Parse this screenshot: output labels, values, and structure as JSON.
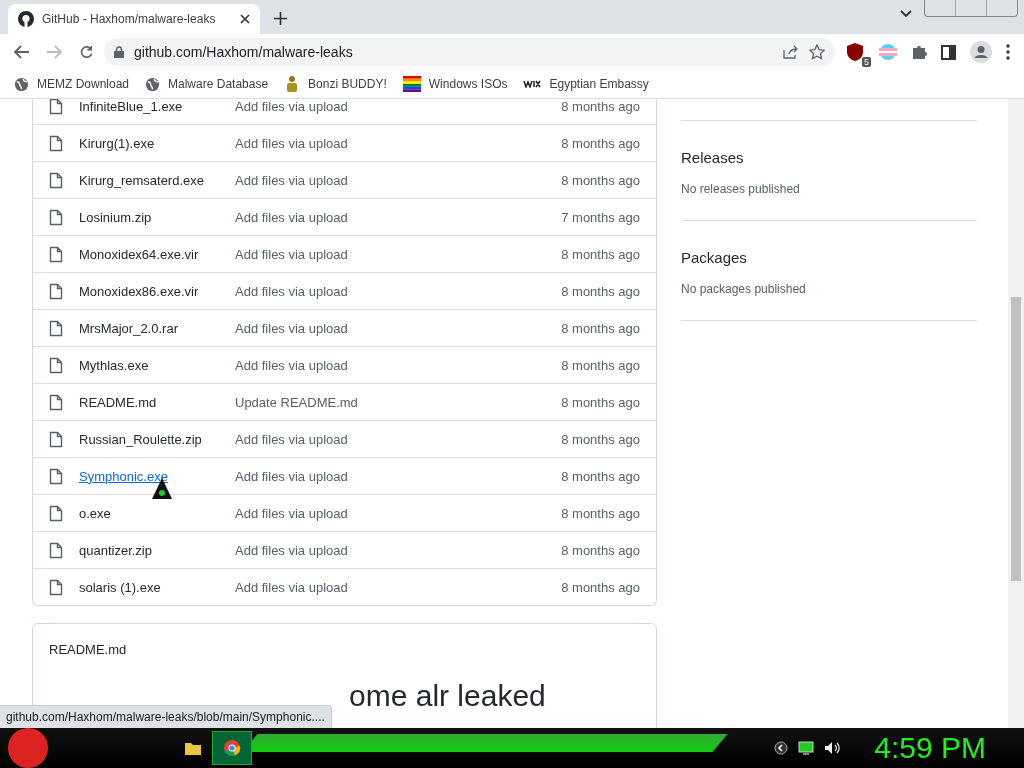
{
  "browser": {
    "tab": {
      "title": "GitHub - Haxhom/malware-leaks",
      "selected": true
    },
    "address": "github.com/Haxhom/malware-leaks",
    "extension_badge": "5",
    "bookmarks": [
      {
        "label": "MEMZ Download",
        "kind": "globe"
      },
      {
        "label": "Malware Database",
        "kind": "globe"
      },
      {
        "label": "Bonzi BUDDY!",
        "kind": "figure"
      },
      {
        "label": "Windows ISOs",
        "kind": "rainbow"
      },
      {
        "label": "Egyptian Embassy",
        "kind": "wix"
      }
    ]
  },
  "files": [
    {
      "name": "InfiniteBlue_1.exe",
      "message": "Add files via upload",
      "age": "8 months ago",
      "hovered": false
    },
    {
      "name": "Kirurg(1).exe",
      "message": "Add files via upload",
      "age": "8 months ago",
      "hovered": false
    },
    {
      "name": "Kirurg_remsaterd.exe",
      "message": "Add files via upload",
      "age": "8 months ago",
      "hovered": false
    },
    {
      "name": "Losinium.zip",
      "message": "Add files via upload",
      "age": "7 months ago",
      "hovered": false
    },
    {
      "name": "Monoxidex64.exe.vir",
      "message": "Add files via upload",
      "age": "8 months ago",
      "hovered": false
    },
    {
      "name": "Monoxidex86.exe.vir",
      "message": "Add files via upload",
      "age": "8 months ago",
      "hovered": false
    },
    {
      "name": "MrsMajor_2.0.rar",
      "message": "Add files via upload",
      "age": "8 months ago",
      "hovered": false
    },
    {
      "name": "Mythlas.exe",
      "message": "Add files via upload",
      "age": "8 months ago",
      "hovered": false
    },
    {
      "name": "README.md",
      "message": "Update README.md",
      "age": "8 months ago",
      "hovered": false
    },
    {
      "name": "Russian_Roulette.zip",
      "message": "Add files via upload",
      "age": "8 months ago",
      "hovered": false
    },
    {
      "name": "Symphonic.exe",
      "message": "Add files via upload",
      "age": "8 months ago",
      "hovered": true
    },
    {
      "name": "o.exe",
      "message": "Add files via upload",
      "age": "8 months ago",
      "hovered": false
    },
    {
      "name": "quantizer.zip",
      "message": "Add files via upload",
      "age": "8 months ago",
      "hovered": false
    },
    {
      "name": "solaris (1).exe",
      "message": "Add files via upload",
      "age": "8 months ago",
      "hovered": false
    }
  ],
  "readme": {
    "title": "README.md",
    "heading": "ome alr leaked"
  },
  "sidebar": [
    {
      "title": "Releases",
      "note": "No releases published"
    },
    {
      "title": "Packages",
      "note": "No packages published"
    }
  ],
  "status_url": "github.com/Haxhom/malware-leaks/blob/main/Symphonic....",
  "taskbar": {
    "clock": "4:59 PM"
  }
}
